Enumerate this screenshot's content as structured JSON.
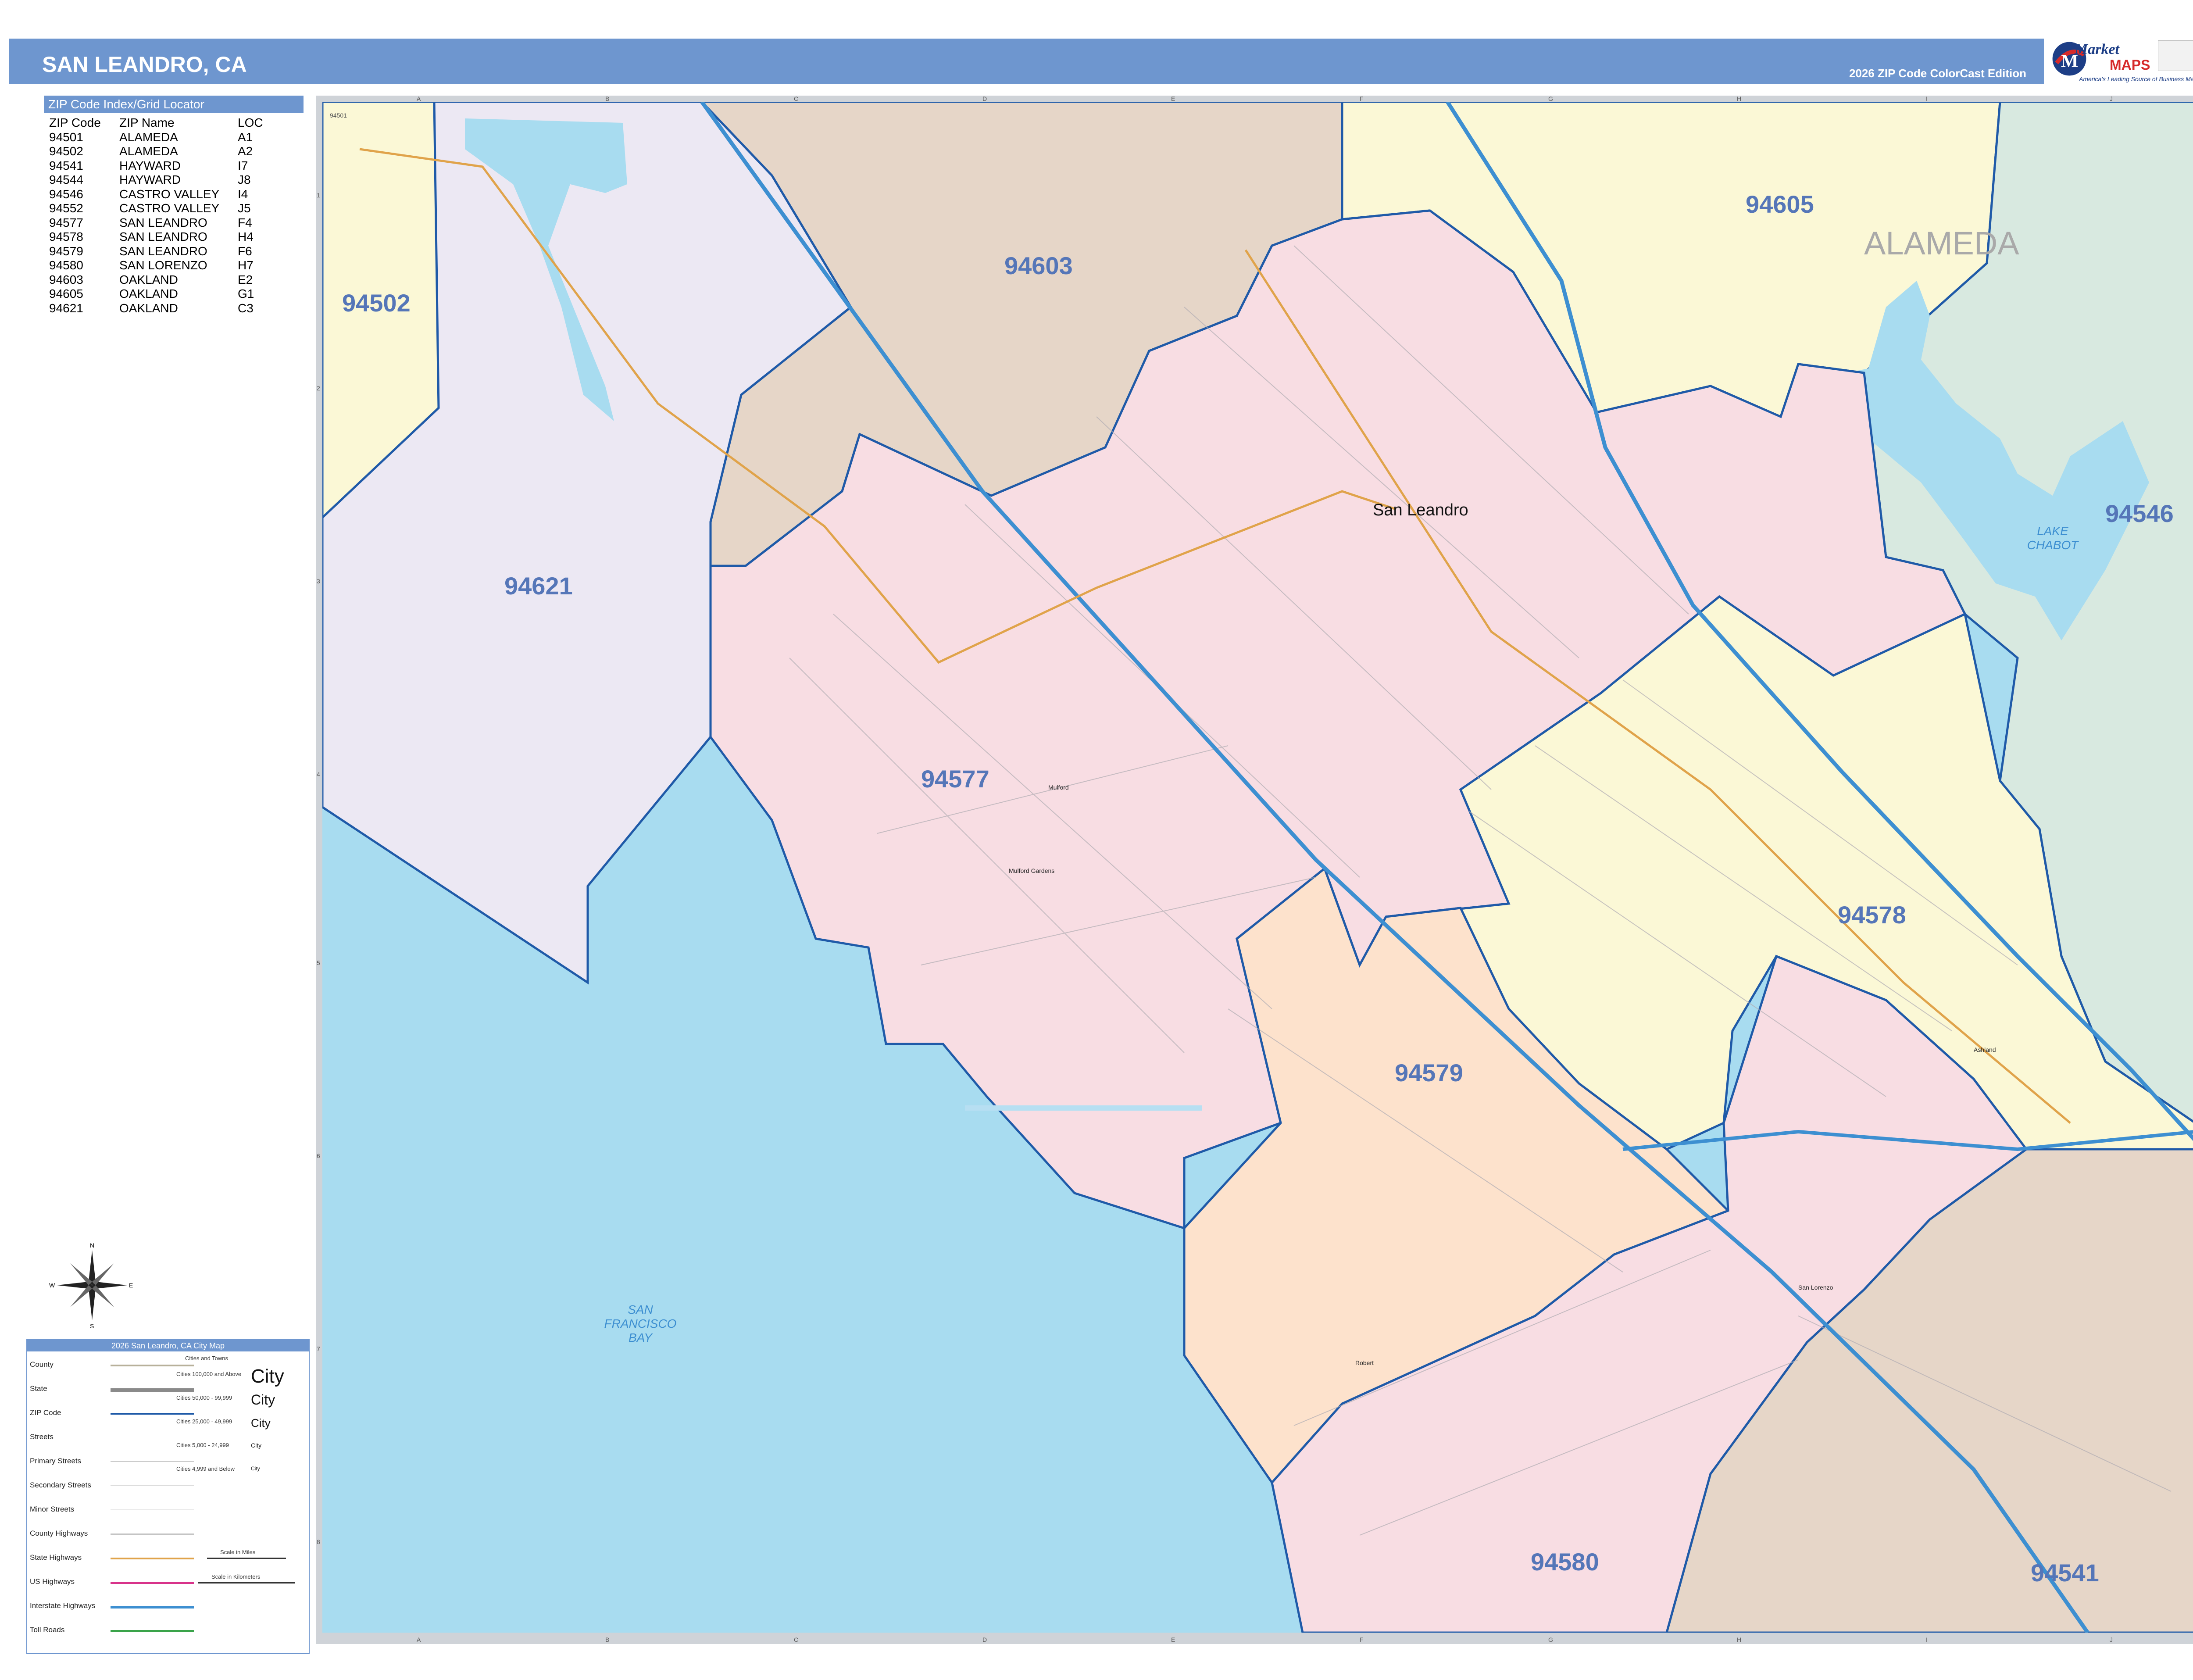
{
  "header": {
    "title": "SAN LEANDRO, CA",
    "edition": "2026 ZIP Code ColorCast Edition"
  },
  "logo": {
    "brand_top": "Market",
    "brand_bottom": "MAPS",
    "tagline": "America's Leading Source of Business Maps",
    "icon": "globe-logo-icon"
  },
  "index": {
    "header": "ZIP Code Index/Grid Locator",
    "columns": [
      "ZIP Code",
      "ZIP Name",
      "LOC"
    ],
    "rows": [
      [
        "94501",
        "ALAMEDA",
        "A1"
      ],
      [
        "94502",
        "ALAMEDA",
        "A2"
      ],
      [
        "94541",
        "HAYWARD",
        "I7"
      ],
      [
        "94544",
        "HAYWARD",
        "J8"
      ],
      [
        "94546",
        "CASTRO VALLEY",
        "I4"
      ],
      [
        "94552",
        "CASTRO VALLEY",
        "J5"
      ],
      [
        "94577",
        "SAN LEANDRO",
        "F4"
      ],
      [
        "94578",
        "SAN LEANDRO",
        "H4"
      ],
      [
        "94579",
        "SAN LEANDRO",
        "F6"
      ],
      [
        "94580",
        "SAN LORENZO",
        "H7"
      ],
      [
        "94603",
        "OAKLAND",
        "E2"
      ],
      [
        "94605",
        "OAKLAND",
        "G1"
      ],
      [
        "94621",
        "OAKLAND",
        "C3"
      ]
    ]
  },
  "map": {
    "grid_cols": [
      "A",
      "B",
      "C",
      "D",
      "E",
      "F",
      "G",
      "H",
      "I",
      "J"
    ],
    "grid_rows": [
      "1",
      "2",
      "3",
      "4",
      "5",
      "6",
      "7",
      "8"
    ],
    "zip_labels": [
      "94502",
      "94603",
      "94605",
      "94621",
      "94546",
      "94577",
      "94578",
      "94579",
      "94580",
      "94541"
    ],
    "county_label": "ALAMEDA",
    "city_label": "San Leandro",
    "water_labels": {
      "lake": [
        "LAKE",
        "CHABOT"
      ],
      "bay": [
        "SAN",
        "FRANCISCO",
        "BAY"
      ]
    },
    "small_places": [
      "Mulford",
      "Mulford Gardens",
      "Ashland",
      "San Lorenzo",
      "Robert"
    ],
    "corner_zip": "94501",
    "colors": {
      "water": "#a8dcf0",
      "zip_94621": "#ece8f3",
      "zip_94603": "#e6d6c8",
      "zip_94502": "#fbf8d6",
      "zip_94605": "#fbf8d6",
      "zip_94577": "#f8dde3",
      "zip_94579": "#fde2cc",
      "zip_94578": "#fbf8d6",
      "zip_94580": "#f8dde3",
      "zip_94546": "#d8e9e0",
      "zip_94541": "#e6d6c8",
      "zip_boundary": "#1f5aa8",
      "zip_label": "#5576b8",
      "interstate": "#3d8fd1",
      "state_highway": "#e0a34a"
    }
  },
  "legend": {
    "title": "2026 San Leandro, CA City Map",
    "items": [
      "County",
      "State",
      "ZIP Code",
      "Streets",
      "Primary Streets",
      "Secondary Streets",
      "Minor Streets",
      "County Highways",
      "State Highways",
      "US Highways",
      "Interstate Highways",
      "Toll Roads"
    ],
    "cities_header": "Cities and Towns",
    "city_sizes": [
      "Cities 100,000 and Above",
      "Cities 50,000 - 99,999",
      "Cities 25,000 - 49,999",
      "Cities 5,000 - 24,999",
      "Cities 4,999 and Below"
    ],
    "city_sample": "City",
    "scale_miles": "Scale in Miles",
    "scale_km": "Scale in Kilometers"
  },
  "compass": {
    "icon": "compass-rose-icon",
    "letters": [
      "N",
      "E",
      "S",
      "W"
    ]
  }
}
